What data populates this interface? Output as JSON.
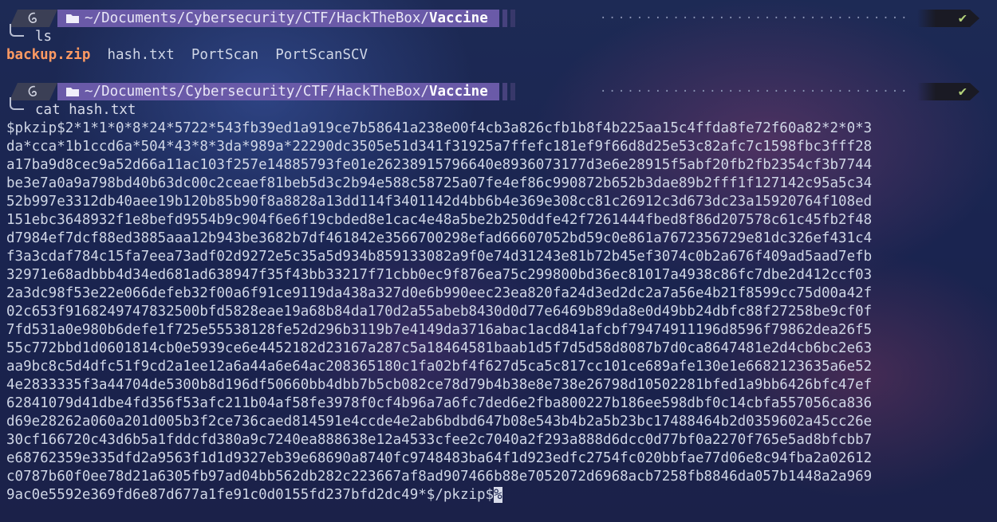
{
  "prompt": {
    "path_prefix": "~/Documents/Cybersecurity/CTF/HackTheBox/",
    "path_current": "Vaccine",
    "status_check": "✔",
    "dots": "································································"
  },
  "commands": [
    {
      "text": "ls"
    },
    {
      "text": "cat hash.txt"
    }
  ],
  "ls_output": [
    "backup.zip",
    "hash.txt",
    "PortScan",
    "PortScanSCV"
  ],
  "hash_lines": [
    "$pkzip$2*1*1*0*8*24*5722*543fb39ed1a919ce7b58641a238e00f4cb3a826cfb1b8f4b225aa15c4ffda8fe72f60a82*2*0*3",
    "da*cca*1b1ccd6a*504*43*8*3da*989a*22290dc3505e51d341f31925a7ffefc181ef9f66d8d25e53c82afc7c1598fbc3fff28",
    "a17ba9d8cec9a52d66a11ac103f257e14885793fe01e26238915796640e8936073177d3e6e28915f5abf20fb2fb2354cf3b7744",
    "be3e7a0a9a798bd40b63dc00c2ceaef81beb5d3c2b94e588c58725a07fe4ef86c990872b652b3dae89b2fff1f127142c95a5c34",
    "52b997e3312db40aee19b120b85b90f8a8828a13dd114f3401142d4bb6b4e369e308cc81c26912c3d673dc23a15920764f108ed",
    "151ebc3648932f1e8befd9554b9c904f6e6f19cbded8e1cac4e48a5be2b250ddfe42f7261444fbed8f86d207578c61c45fb2f48",
    "d7984ef7dcf88ed3885aaa12b943be3682b7df461842e3566700298efad66607052bd59c0e861a7672356729e81dc326ef431c4",
    "f3a3cdaf784c15fa7eea73adf02d9272e5c35a5d934b859133082a9f0e74d31243e81b72b45ef3074c0b2a676f409ad5aad7efb",
    "32971e68adbbb4d34ed681ad638947f35f43bb33217f71cbb0ec9f876ea75c299800bd36ec81017a4938c86fc7dbe2d412ccf03",
    "2a3dc98f53e22e066defeb32f00a6f91ce9119da438a327d0e6b990eec23ea820fa24d3ed2dc2a7a56e4b21f8599cc75d00a42f",
    "02c653f9168249747832500bfd5828eae19a68b84da170d2a55abeb8430d0d77e6469b89da8e0d49bb24dbfc88f27258be9cf0f",
    "7fd531a0e980b6defe1f725e55538128fe52d296b3119b7e4149da3716abac1acd841afcbf79474911196d8596f79862dea26f5",
    "55c772bbd1d0601814cb0e5939ce6e4452182d23167a287c5a18464581baab1d5f7d5d58d8087b7d0ca8647481e2d4cb6bc2e63",
    "aa9bc8c5d4dfc51f9cd2a1ee12a6a44a6e64ac208365180c1fa02bf4f627d5ca5c817cc101ce689afe130e1e6682123635a6e52",
    "4e2833335f3a44704de5300b8d196df50660bb4dbb7b5cb082ce78d79b4b38e8e738e26798d10502281bfed1a9bb6426bfc47ef",
    "62841079d41dbe4fd356f53afc211b04af58fe3978f0cf4b96a7a6fc7ded6e2fba800227b186ee598dbf0c14cbfa557056ca836",
    "d69e28262a060a201d005b3f2ce736caed814591e4ccde4e2ab6bdbd647b08e543b4b2a5b23bc17488464b2d0359602a45cc26e",
    "30cf166720c43d6b5a1fddcfd380a9c7240ea888638e12a4533cfee2c7040a2f293a888d6dcc0d77bf0a2270f765e5ad8bfcbb7",
    "e68762359e335dfd2a9563f1d1d9327eb39e68690a8740fc9748483ba64f1d923edfc2754fc020bbfae77d06e8c94fba2a02612",
    "c0787b60f0ee78d21a6305fb97ad04bb562db282c223667af8ad907466b88e7052072d6968acb7258fb8846da057b1448a2a969",
    "9ac0e5592e369fd6e87d677a1fe91c0d0155fd237bfd2dc49*$/pkzip$"
  ],
  "cursor_char": "%",
  "colors": {
    "path_bg": "#6a5aa8",
    "zip": "#ff9a62",
    "check": "#b4d27a",
    "bg": "#1d2a55"
  }
}
